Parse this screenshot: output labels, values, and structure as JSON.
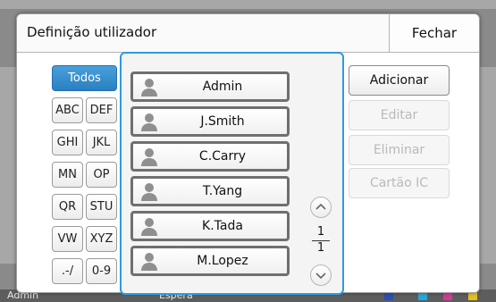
{
  "dialog": {
    "title": "Definição utilizador",
    "close_label": "Fechar"
  },
  "filter": {
    "keys": [
      "Todos",
      "ABC",
      "DEF",
      "GHI",
      "JKL",
      "MN",
      "OP",
      "QR",
      "STU",
      "VW",
      "XYZ",
      ".-/",
      "0-9"
    ],
    "selected": "Todos"
  },
  "users": [
    "Admin",
    "J.Smith",
    "C.Carry",
    "T.Yang",
    "K.Tada",
    "M.Lopez"
  ],
  "pager": {
    "current": "1",
    "total": "1"
  },
  "actions": {
    "add": "Adicionar",
    "edit": "Editar",
    "delete": "Eliminar",
    "ic_card": "Cartão IC"
  },
  "background": {
    "user": "Admin",
    "status": "Espera",
    "ink_colors": [
      "#2d4fb3",
      "#27a7d8",
      "#d23a9c",
      "#e2c21a"
    ]
  },
  "colors": {
    "accent": "#2b9be0",
    "selected_key": "#2a7fc1",
    "disabled_text": "#b9b9b9"
  }
}
